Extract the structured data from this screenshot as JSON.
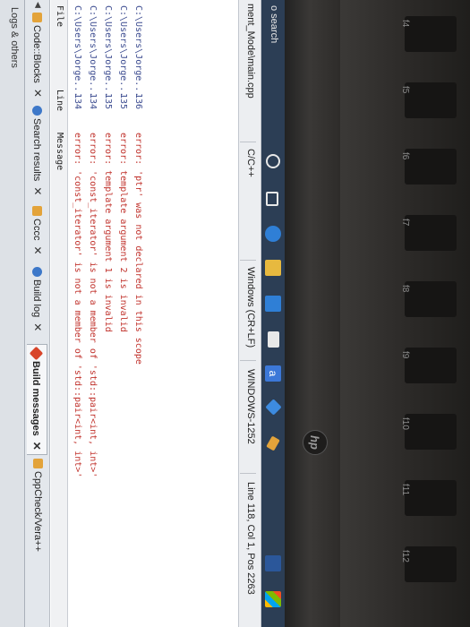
{
  "top_strip": {
    "text": "Logs & others"
  },
  "tabs": [
    {
      "label": "Code::Blocks",
      "icon": "codeblocks-icon",
      "color": "#e3a33a"
    },
    {
      "label": "Search results",
      "icon": "search-icon",
      "color": "#3d78c9"
    },
    {
      "label": "Cccc",
      "icon": "cccc-icon",
      "color": "#e3a33a"
    },
    {
      "label": "Build log",
      "icon": "gear-icon",
      "color": "#3d78c9"
    },
    {
      "label": "Build messages",
      "icon": "build-messages-icon",
      "color": "#d8452a",
      "active": true
    },
    {
      "label": "CppCheck/Vera++",
      "icon": "cppcheck-icon",
      "color": "#e3a33a"
    }
  ],
  "table": {
    "headers": {
      "file": "File",
      "line": "Line",
      "message": "Message"
    },
    "rows": [
      {
        "file": "C:\\Users\\Jorge...",
        "line": "134",
        "message": "error: 'const_iterator' is not a member of 'std::pair<int, int>'"
      },
      {
        "file": "C:\\Users\\Jorge...",
        "line": "134",
        "message": "error: 'const_iterator' is not a member of 'std::pair<int, int>'"
      },
      {
        "file": "C:\\Users\\Jorge...",
        "line": "135",
        "message": "error: template argument 1 is invalid"
      },
      {
        "file": "C:\\Users\\Jorge...",
        "line": "135",
        "message": "error: template argument 2 is invalid"
      },
      {
        "file": "C:\\Users\\Jorge...",
        "line": "136",
        "message": "error: 'ptr' was not declared in this scope"
      }
    ]
  },
  "status_bar": {
    "path": "ment_Mode\\main.cpp",
    "language": "C/C++",
    "line_endings": "Windows (CR+LF)",
    "encoding": "WINDOWS-1252",
    "position": "Line 118, Col 1, Pos 2263"
  },
  "taskbar": {
    "search_text": "o search",
    "icons": [
      {
        "name": "cortana-icon",
        "color": "#2c3e55"
      },
      {
        "name": "task-view-icon",
        "color": "#2c3e55"
      },
      {
        "name": "edge-icon",
        "color": "#2f7fd6"
      },
      {
        "name": "file-explorer-icon",
        "color": "#e7b93f"
      },
      {
        "name": "store-icon",
        "color": "#2f7fd6"
      },
      {
        "name": "mail-icon",
        "color": "#e8e8e8"
      },
      {
        "name": "amazon-icon",
        "color": "#3c78d8"
      },
      {
        "name": "dropbox-icon",
        "color": "#3d8be0"
      },
      {
        "name": "codeblocks-icon",
        "color": "#e3a33a"
      },
      {
        "name": "word-icon",
        "color": "#2b579a"
      }
    ]
  },
  "keyboard": {
    "keys": [
      "f4",
      "f5",
      "f6",
      "f7",
      "f8",
      "f9",
      "f10",
      "f11",
      "f12"
    ]
  }
}
